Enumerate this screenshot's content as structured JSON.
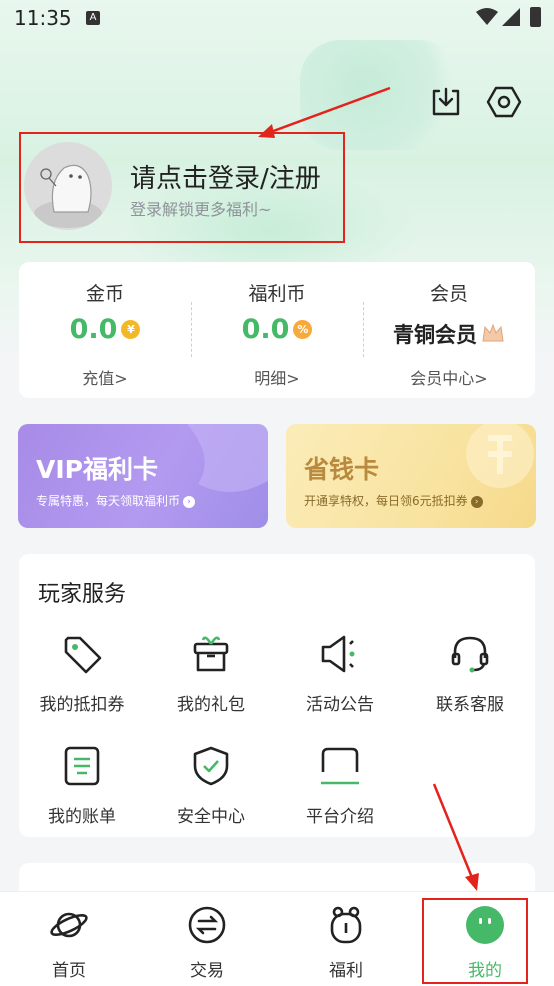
{
  "status_bar": {
    "time": "11:35"
  },
  "header": {
    "login_title": "请点击登录/注册",
    "login_subtitle": "登录解锁更多福利~",
    "download_icon": "download-icon",
    "settings_icon": "hexagon-settings-icon"
  },
  "stats": [
    {
      "label": "金币",
      "value": "0.0",
      "badge": "¥",
      "link": "充值>"
    },
    {
      "label": "福利币",
      "value": "0.0",
      "badge": "%",
      "link": "明细>"
    },
    {
      "label": "会员",
      "value": "青铜会员",
      "link": "会员中心>"
    }
  ],
  "promos": {
    "vip": {
      "title": "VIP福利卡",
      "subtitle": "专属特惠，每天领取福利币"
    },
    "save": {
      "title": "省钱卡",
      "subtitle": "开通享特权，每日领6元抵扣券"
    }
  },
  "services": {
    "title": "玩家服务",
    "items": [
      {
        "label": "我的抵扣券",
        "icon": "tag-icon"
      },
      {
        "label": "我的礼包",
        "icon": "gift-icon"
      },
      {
        "label": "活动公告",
        "icon": "speaker-icon"
      },
      {
        "label": "联系客服",
        "icon": "headset-icon"
      },
      {
        "label": "我的账单",
        "icon": "bill-icon"
      },
      {
        "label": "安全中心",
        "icon": "shield-icon"
      },
      {
        "label": "平台介绍",
        "icon": "platform-icon"
      }
    ]
  },
  "tabs": [
    {
      "label": "首页",
      "icon": "planet-icon"
    },
    {
      "label": "交易",
      "icon": "exchange-icon"
    },
    {
      "label": "福利",
      "icon": "clock-icon"
    },
    {
      "label": "我的",
      "icon": "face-icon",
      "active": true
    }
  ],
  "colors": {
    "accent": "#46b968",
    "annotation_red": "#e2241c",
    "vip_purple": "#a78be7",
    "save_gold": "#f8e3a0"
  }
}
